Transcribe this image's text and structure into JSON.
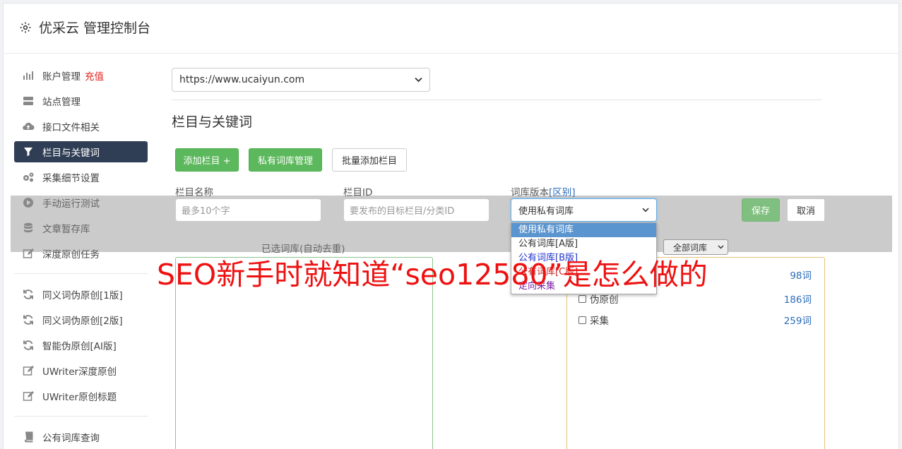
{
  "header": {
    "title": "优采云 管理控制台"
  },
  "sidebar": {
    "group1": [
      {
        "label": "账户管理",
        "badge": "充值",
        "icon": "bar-chart-icon"
      },
      {
        "label": "站点管理",
        "icon": "server-icon"
      },
      {
        "label": "接口文件相关",
        "icon": "cloud-upload-icon"
      },
      {
        "label": "栏目与关键词",
        "icon": "filter-icon",
        "active": true
      },
      {
        "label": "采集细节设置",
        "icon": "gears-icon"
      },
      {
        "label": "手动运行测试",
        "icon": "play-icon"
      },
      {
        "label": "文章暂存库",
        "icon": "database-icon"
      },
      {
        "label": "深度原创任务",
        "icon": "edit-icon"
      }
    ],
    "group2": [
      {
        "label": "同义词伪原创[1版]",
        "icon": "refresh-icon"
      },
      {
        "label": "同义词伪原创[2版]",
        "icon": "refresh-icon"
      },
      {
        "label": "智能伪原创[AI版]",
        "icon": "refresh-icon"
      },
      {
        "label": "UWriter深度原创",
        "icon": "edit-icon"
      },
      {
        "label": "UWriter原创标题",
        "icon": "edit-icon"
      }
    ],
    "group3": [
      {
        "label": "公有词库查询",
        "icon": "book-icon"
      }
    ]
  },
  "main": {
    "site_select": "https://www.ucaiyun.com",
    "section_title": "栏目与关键词",
    "buttons": {
      "add_column": "添加栏目 +",
      "private_lib": "私有词库管理",
      "batch_add": "批量添加栏目"
    },
    "form": {
      "name_label": "栏目名称",
      "name_placeholder": "最多10个字",
      "id_label": "栏目ID",
      "id_placeholder": "要发布的目标栏目/分类ID",
      "version_label": "词库版本",
      "version_link": "[区别]",
      "version_value": "使用私有词库",
      "save": "保存",
      "cancel": "取消"
    },
    "dropdown_options": [
      "使用私有词库",
      "公有词库[A版]",
      "公有词库[B版]",
      "公有词库[C版]",
      "定向采集"
    ],
    "selected_label": "已选词库(自动去重)",
    "filter_select": "全部词库",
    "categories": [
      {
        "label": "",
        "count": "98词"
      },
      {
        "label": "伪原创",
        "count": "186词"
      },
      {
        "label": "采集",
        "count": "259词"
      }
    ]
  },
  "watermark": "SEO新手时就知道“seo12580”是怎么做的"
}
